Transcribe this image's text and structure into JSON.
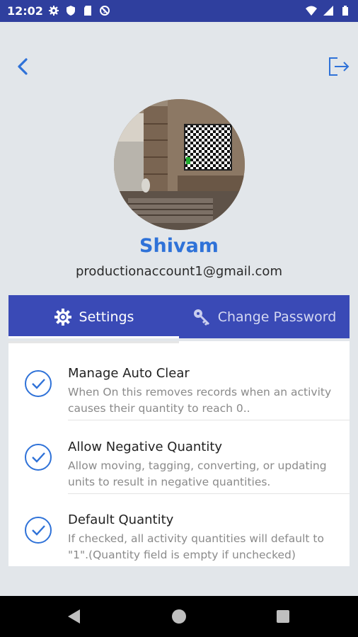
{
  "status_bar": {
    "time": "12:02",
    "left_icons": [
      "settings-gear-icon",
      "shield-icon",
      "sd-card-icon",
      "no-disturb-icon"
    ],
    "right_icons": [
      "wifi-icon",
      "signal-icon",
      "battery-icon"
    ]
  },
  "header": {
    "back_icon": "chevron-left-icon",
    "logout_icon": "logout-icon"
  },
  "profile": {
    "name": "Shivam",
    "email": "productionaccount1@gmail.com"
  },
  "tabs": [
    {
      "label": "Settings",
      "icon": "gear-icon",
      "active": true
    },
    {
      "label": "Change Password",
      "icon": "key-icon",
      "active": false
    }
  ],
  "settings": [
    {
      "title": "Manage Auto Clear",
      "description": "When On this removes records when an activity causes their quantity to reach 0..",
      "checked": true
    },
    {
      "title": "Allow Negative Quantity",
      "description": "Allow moving, tagging, converting, or updating units to result in negative quantities.",
      "checked": true
    },
    {
      "title": "Default Quantity",
      "description": "If checked, all activity quantities will default to \"1\".(Quantity field is empty if unchecked)",
      "checked": true
    }
  ],
  "colors": {
    "primary": "#3a4ab6",
    "status_bar": "#2f3f9e",
    "accent_blue": "#2f72d8",
    "background": "#e2e6ea"
  },
  "nav_bar": [
    "back-triangle-icon",
    "home-circle-icon",
    "recents-square-icon"
  ]
}
